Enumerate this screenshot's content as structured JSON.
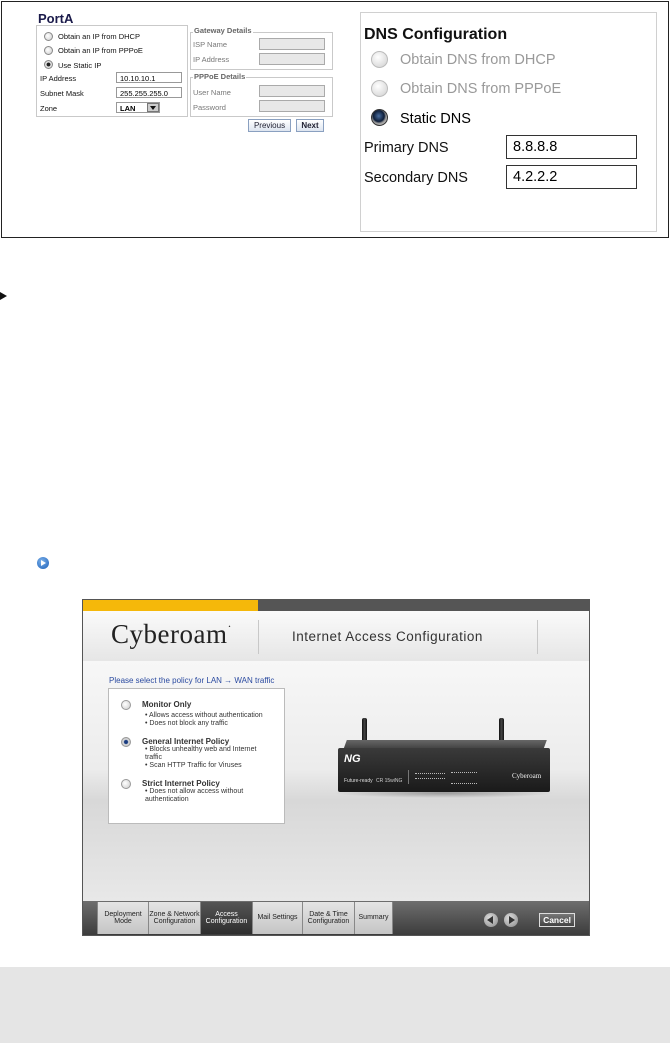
{
  "porta": {
    "title": "PortA",
    "options": [
      {
        "label": "Obtain an IP from DHCP",
        "selected": false
      },
      {
        "label": "Obtain an IP from PPPoE",
        "selected": false
      },
      {
        "label": "Use Static IP",
        "selected": true
      }
    ],
    "ip_label": "IP Address",
    "ip_value": "10.10.10.1",
    "mask_label": "Subnet Mask",
    "mask_value": "255.255.255.0",
    "zone_label": "Zone",
    "zone_value": "LAN",
    "gateway": {
      "title": "Gateway Details",
      "isp_label": "ISP Name",
      "ip_label": "IP Address"
    },
    "pppoe": {
      "title": "PPPoE Details",
      "user_label": "User Name",
      "pass_label": "Password"
    },
    "previous": "Previous",
    "next": "Next"
  },
  "dns": {
    "title": "DNS Configuration",
    "options": [
      {
        "label": "Obtain DNS from DHCP",
        "selected": false
      },
      {
        "label": "Obtain DNS from PPPoE",
        "selected": false
      },
      {
        "label": "Static DNS",
        "selected": true
      }
    ],
    "primary_label": "Primary DNS",
    "primary_value": "8.8.8.8",
    "secondary_label": "Secondary DNS",
    "secondary_value": "4.2.2.2"
  },
  "cyberoam": {
    "logo": "Cyberoam",
    "logo_mark": "·",
    "page_title": "Internet Access Configuration",
    "prompt": "Please select the policy for LAN → WAN traffic",
    "policies": [
      {
        "name": "Monitor Only",
        "selected": false,
        "bullets": [
          "• Allows access without authentication",
          "• Does not block any traffic"
        ]
      },
      {
        "name": "General Internet Policy",
        "selected": true,
        "bullets": [
          "• Blocks unhealthy web and Internet traffic",
          "• Scan HTTP Traffic for Viruses"
        ]
      },
      {
        "name": "Strict Internet Policy",
        "selected": false,
        "bullets": [
          "• Does not allow access without authentication"
        ]
      }
    ],
    "steps": [
      "Deployment Mode",
      "Zone & Network Configuration",
      "Access Configuration",
      "Mail Settings",
      "Date & Time Configuration",
      "Summary"
    ],
    "active_step": 2,
    "cancel": "Cancel",
    "device": {
      "brand": "Cyberoam",
      "badge": "NG",
      "tagline": "Future-ready",
      "model": "CR 15wiNG"
    }
  },
  "colors": {
    "accent_yellow": "#f5b80a",
    "link_blue": "#2a4aa0",
    "footer_dark": "#3c3c3c"
  }
}
